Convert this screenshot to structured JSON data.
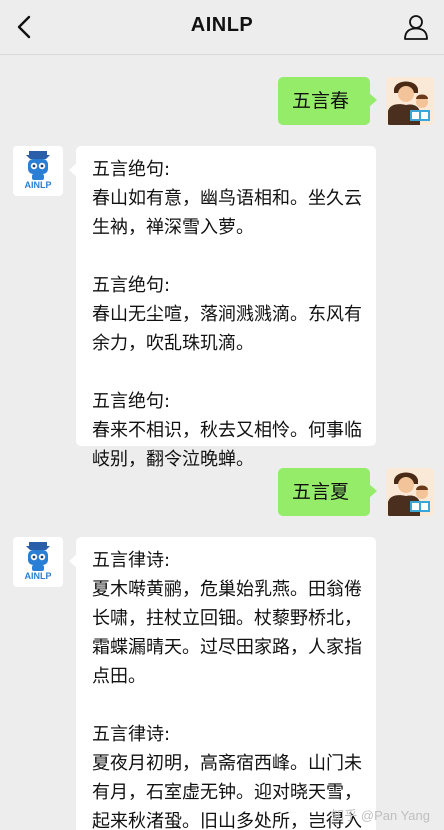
{
  "header": {
    "title": "AINLP",
    "back_icon": "chevron-left-icon",
    "profile_icon": "person-icon"
  },
  "bot": {
    "name": "AINLP"
  },
  "messages": [
    {
      "from": "user",
      "text": "五言春"
    },
    {
      "from": "bot",
      "poems": [
        {
          "label": "五言绝句:",
          "text": "春山如有意，幽鸟语相和。坐久云生衲，禅深雪入萝。"
        },
        {
          "label": "五言绝句:",
          "text": "春山无尘喧，落涧溅溅滴。东风有余力，吹乱珠玑滴。"
        },
        {
          "label": "五言绝句:",
          "text": "春来不相识，秋去又相怜。何事临岐别，翻令泣晚蝉。"
        }
      ]
    },
    {
      "from": "user",
      "text": "五言夏"
    },
    {
      "from": "bot",
      "poems": [
        {
          "label": "五言律诗:",
          "text": "夏木啭黄鹂，危巢始乳燕。田翁倦长啸，拄杖立回钿。杖藜野桥北，霜蝶漏晴天。过尽田家路，人家指点田。"
        },
        {
          "label": "五言律诗:",
          "text": "夏夜月初明，高斋宿西峰。山门未有月，石室虚无钟。迎对晓天雪，起来秋渚蛩。旧山多处所，岂得入深松。"
        }
      ]
    }
  ],
  "watermark": "知乎 @Pan Yang",
  "colors": {
    "background": "#ededed",
    "user_bubble": "#95ec69",
    "bot_bubble": "#ffffff",
    "bot_brand": "#2a7fd4"
  }
}
